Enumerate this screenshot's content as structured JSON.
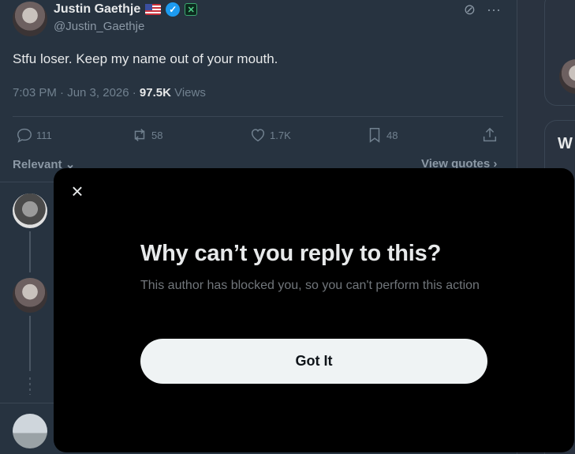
{
  "tweet": {
    "author_name": "Justin Gaethje",
    "handle": "@Justin_Gaethje",
    "text": "Stfu loser. Keep my name out of your mouth.",
    "time": "7:03 PM · Jun 3, 2026 · ",
    "views_count": "97.5K",
    "views_label": " Views",
    "badges": [
      "us-flag-icon",
      "verified-badge-icon",
      "affiliate-badge-icon"
    ],
    "top_icons": [
      "grok-icon",
      "more-icon"
    ]
  },
  "actions": {
    "replies": "111",
    "reposts": "58",
    "likes": "1.7K",
    "bookmarks": "48"
  },
  "replies_bar": {
    "sort_label": "Relevant",
    "view_quotes": "View quotes"
  },
  "right_col": {
    "card_title": "W"
  },
  "modal": {
    "title": "Why can’t you reply to this?",
    "description": "This author has blocked you, so you can't perform this action",
    "button_label": "Got It"
  },
  "colors": {
    "accent": "#1d9bf0",
    "modal_bg": "#000000",
    "button_bg": "#eff3f4",
    "muted_text": "#71767b"
  }
}
